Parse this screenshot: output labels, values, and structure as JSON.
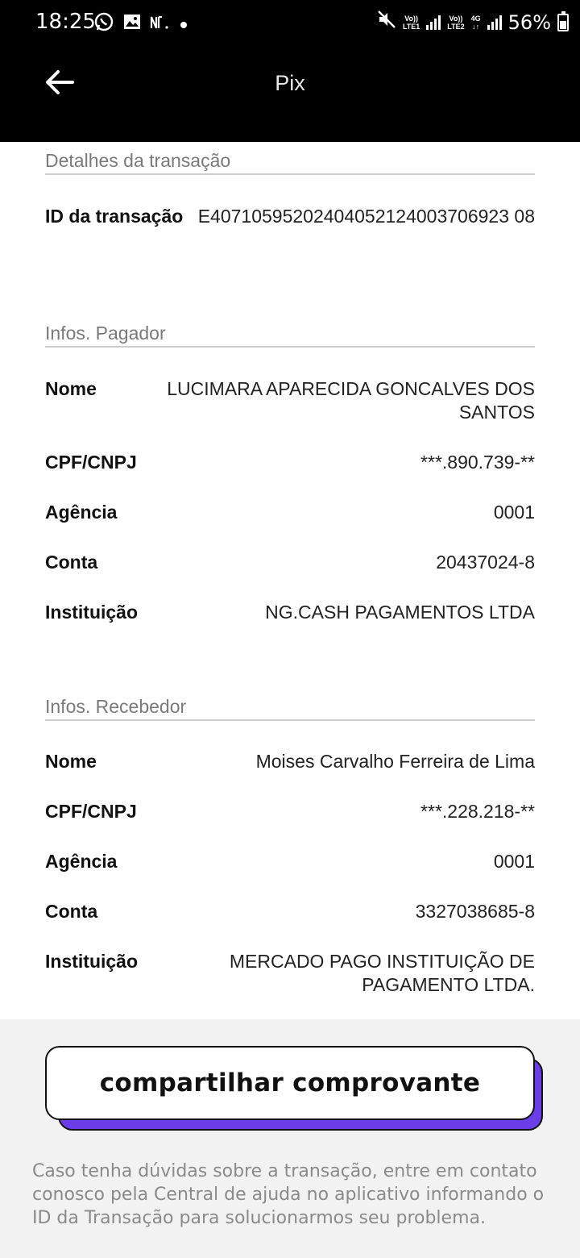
{
  "status_bar": {
    "time": "18:25",
    "battery": "56%",
    "network_sim1": [
      "Vo))",
      "LTE1"
    ],
    "network_sim2": [
      "Vo))",
      "LTE2"
    ],
    "network_type": "4G"
  },
  "app_bar": {
    "title": "Pix"
  },
  "transaction": {
    "section_title": "Detalhes da transação",
    "id_label": "ID da transação",
    "id_value": "E40710595202404052124003706923 08"
  },
  "payer": {
    "section_title": "Infos. Pagador",
    "rows": [
      {
        "label": "Nome",
        "value": "LUCIMARA APARECIDA GONCALVES DOS SANTOS"
      },
      {
        "label": "CPF/CNPJ",
        "value": "***.890.739-**"
      },
      {
        "label": "Agência",
        "value": "0001"
      },
      {
        "label": "Conta",
        "value": "20437024-8"
      },
      {
        "label": "Instituição",
        "value": "NG.CASH PAGAMENTOS LTDA"
      }
    ]
  },
  "receiver": {
    "section_title": "Infos. Recebedor",
    "rows": [
      {
        "label": "Nome",
        "value": "Moises Carvalho Ferreira de Lima"
      },
      {
        "label": "CPF/CNPJ",
        "value": "***.228.218-**"
      },
      {
        "label": "Agência",
        "value": "0001"
      },
      {
        "label": "Conta",
        "value": "3327038685-8"
      },
      {
        "label": "Instituição",
        "value": "MERCADO PAGO INSTITUIÇÃO DE PAGAMENTO LTDA."
      }
    ]
  },
  "footer": {
    "share_button": "compartilhar comprovante",
    "help_text": "Caso tenha dúvidas sobre a transação, entre em contato conosco pela Central de ajuda no aplicativo informando o ID da Transação para solucionarmos seu problema."
  },
  "colors": {
    "accent": "#6a3de8",
    "header_bg": "#000000",
    "footer_bg": "#f2f2f2"
  }
}
